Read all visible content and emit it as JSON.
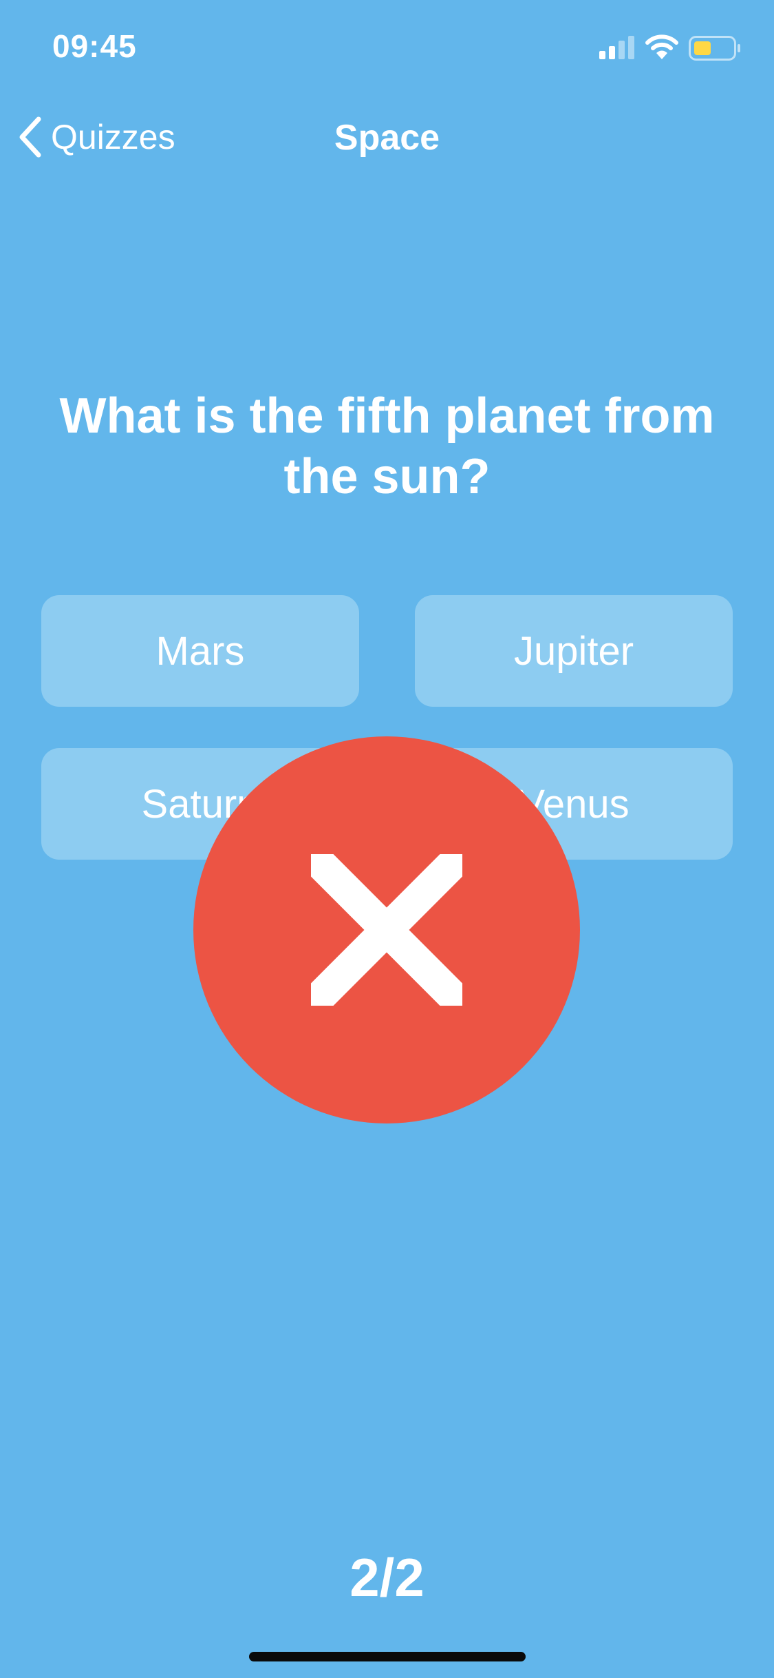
{
  "status_bar": {
    "time": "09:45",
    "battery_color": "#FFD845"
  },
  "nav": {
    "back_label": "Quizzes",
    "title": "Space"
  },
  "question": {
    "text": "What is the fifth planet from the sun?"
  },
  "answers": [
    {
      "label": "Mars"
    },
    {
      "label": "Jupiter"
    },
    {
      "label": "Saturn"
    },
    {
      "label": "Venus"
    }
  ],
  "feedback": {
    "result": "wrong",
    "icon": "close-icon",
    "color": "#EC5444"
  },
  "progress": {
    "text": "2/2"
  },
  "colors": {
    "background": "#62B6EB",
    "answer_button": "#8DCCF1"
  }
}
